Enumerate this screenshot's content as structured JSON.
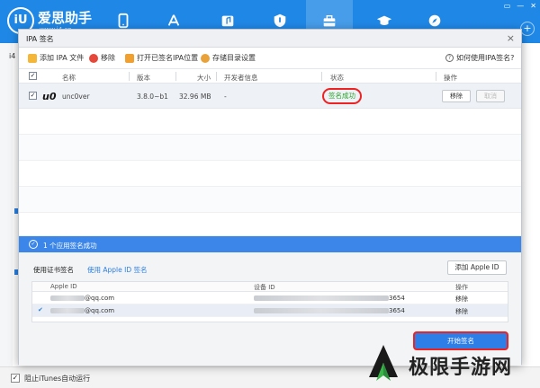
{
  "app": {
    "brand_logo_text": "iU",
    "brand_name": "爱思助手",
    "brand_url": "www.i4.cn",
    "side_text": "i4",
    "itunes_label": "阻止iTunes自动运行",
    "nav_icons": [
      "phone-icon",
      "appstore-icon",
      "music-icon",
      "ringtone-icon",
      "toolbox-icon",
      "graduation-icon",
      "compass-icon"
    ],
    "win_buttons": [
      "▭",
      "—",
      "✕"
    ]
  },
  "dialog": {
    "title": "IPA 签名",
    "close": "×",
    "toolbar": {
      "add_ipa": "添加 IPA 文件",
      "remove": "移除",
      "open_location": "打开已签名IPA位置",
      "storage_settings": "存储目录设置",
      "help": "如何使用IPA签名?"
    },
    "table": {
      "columns": [
        "名称",
        "版本",
        "大小",
        "开发者信息",
        "状态",
        "操作"
      ],
      "rows": [
        {
          "checked": true,
          "icon_text": "u0",
          "name": "unc0ver",
          "version": "3.8.0~b1",
          "size": "32.96 MB",
          "developer": "-",
          "status": "签名成功",
          "action_remove": "移除",
          "action_cancel": "取消"
        }
      ]
    },
    "status_bar": {
      "icon": "✓",
      "text": "1 个应用签名成功"
    },
    "lower": {
      "tab_cert": "使用证书签名",
      "tab_apple_id": "使用 Apple ID 签名",
      "add_apple_id": "添加 Apple ID",
      "accounts_header": [
        "Apple ID",
        "设备 ID",
        "操作"
      ],
      "accounts": [
        {
          "email_suffix": "@qq.com",
          "device_suffix": "3654",
          "action": "移除",
          "selected": false
        },
        {
          "email_suffix": "@qq.com",
          "device_suffix": "3654",
          "action": "移除",
          "selected": true
        }
      ],
      "start_button": "开始签名"
    }
  },
  "watermark": {
    "text": "极限手游网"
  }
}
